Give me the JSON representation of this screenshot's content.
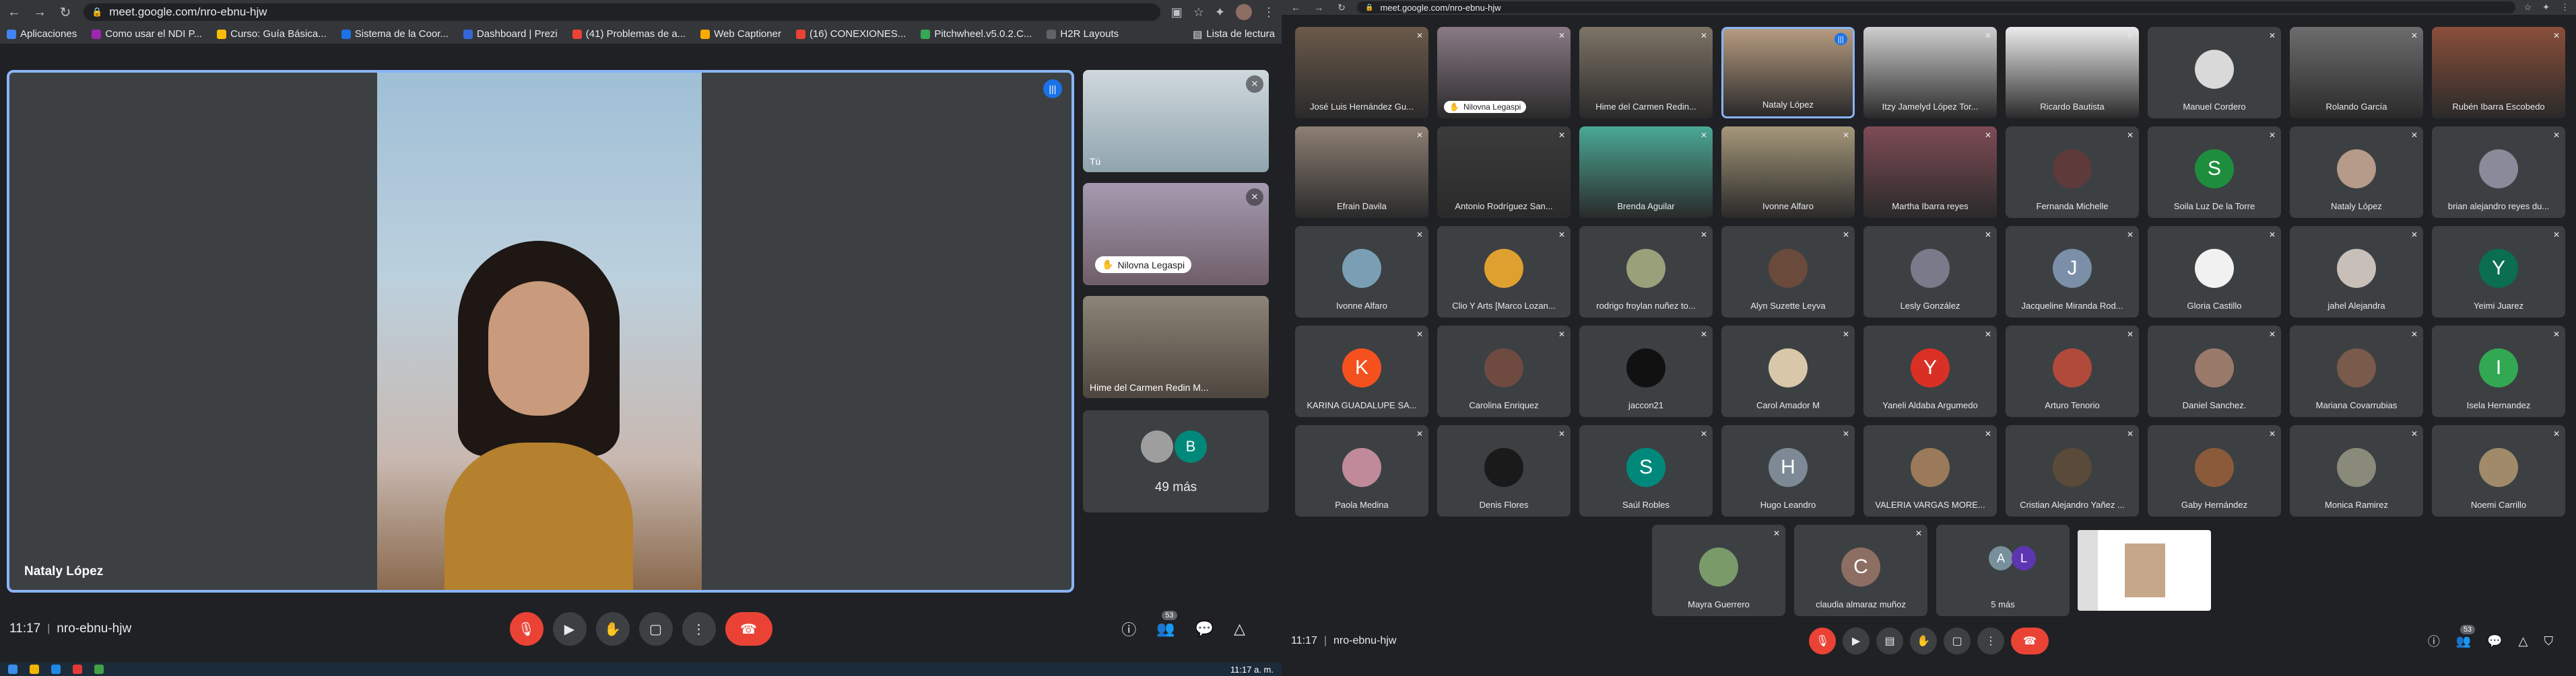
{
  "left": {
    "url": "meet.google.com/nro-ebnu-hjw",
    "bookmarks": [
      "Aplicaciones",
      "Como usar el NDI P...",
      "Curso: Guía Básica...",
      "Sistema de la Coor...",
      "Dashboard | Prezi",
      "(41) Problemas de a...",
      "Web Captioner",
      "(16) CONEXIONES...",
      "Pitchwheel.v5.0.2.C...",
      "H2R Layouts"
    ],
    "reading_list": "Lista de lectura",
    "main_name": "Nataly López",
    "side": [
      {
        "name": "Tú"
      },
      {
        "name": "Nilovna Legaspi"
      },
      {
        "name": "Hime del Carmen Redin M..."
      }
    ],
    "more_letter": "B",
    "more_label": "49 más",
    "time": "11:17",
    "code": "nro-ebnu-hjw",
    "participants_count": "53",
    "taskbar_time": "11:17 a. m."
  },
  "right": {
    "url": "meet.google.com/nro-ebnu-hjw",
    "tiles": [
      {
        "name": "José Luis Hernández Gu...",
        "type": "video",
        "bg": "#6b5a4a"
      },
      {
        "name": "Nilovna Legaspi",
        "type": "video",
        "bg": "#8a7a86",
        "pill": true
      },
      {
        "name": "Hime del Carmen Redin...",
        "type": "video",
        "bg": "#7d7466"
      },
      {
        "name": "Nataly López",
        "type": "video",
        "bg": "#b69b7f",
        "speaking": true
      },
      {
        "name": "Itzy Jamelyd López Tor...",
        "type": "video",
        "bg": "#cfcfcf"
      },
      {
        "name": "Ricardo Bautista",
        "type": "video",
        "bg": "#ececec"
      },
      {
        "name": "Manuel Cordero",
        "type": "avatar",
        "bg": "#d9d9d9",
        "letter": ""
      },
      {
        "name": "Rolando García",
        "type": "video",
        "bg": "#6d6d6d"
      },
      {
        "name": "Rubén Ibarra Escobedo",
        "type": "video",
        "bg": "#8a4f3a"
      },
      {
        "name": "Efrain Davila",
        "type": "video",
        "bg": "#8d7f73"
      },
      {
        "name": "Antonio Rodríguez San...",
        "type": "video",
        "bg": "#3b3b3b"
      },
      {
        "name": "Brenda Aguilar",
        "type": "video",
        "bg": "#4aa895"
      },
      {
        "name": "Ivonne Alfaro",
        "type": "video",
        "bg": "#a5977a"
      },
      {
        "name": "Martha Ibarra reyes",
        "type": "video",
        "bg": "#7e4b55"
      },
      {
        "name": "Fernanda Michelle",
        "type": "avatar",
        "bg": "#5e3a3a",
        "letter": ""
      },
      {
        "name": "Soila Luz De la Torre",
        "type": "avatar",
        "bg": "#1e8e3e",
        "letter": "S"
      },
      {
        "name": "Nataly López",
        "type": "avatar",
        "bg": "#b59b88",
        "letter": ""
      },
      {
        "name": "brian alejandro reyes du...",
        "type": "avatar",
        "bg": "#8a8a9a",
        "letter": ""
      },
      {
        "name": "Ivonne Alfaro",
        "type": "avatar",
        "bg": "#7a9fb5",
        "letter": ""
      },
      {
        "name": "Clio Y Arts [Marco Lozan...",
        "type": "avatar",
        "bg": "#e0a030",
        "letter": ""
      },
      {
        "name": "rodrigo froylan nuñez to...",
        "type": "avatar",
        "bg": "#9aa07a",
        "letter": ""
      },
      {
        "name": "Alyn Suzette Leyva",
        "type": "avatar",
        "bg": "#6a4a3a",
        "letter": ""
      },
      {
        "name": "Lesly González",
        "type": "avatar",
        "bg": "#7a7a8a",
        "letter": ""
      },
      {
        "name": "Jacqueline Miranda Rod...",
        "type": "avatar",
        "bg": "#7b8fa8",
        "letter": "J"
      },
      {
        "name": "Gloria Castillo",
        "type": "avatar",
        "bg": "#f1f1f1",
        "letter": ""
      },
      {
        "name": "jahel Alejandra",
        "type": "avatar",
        "bg": "#c8c0b8",
        "letter": ""
      },
      {
        "name": "Yeimi Juarez",
        "type": "avatar",
        "bg": "#0b6e4f",
        "letter": "Y"
      },
      {
        "name": "KARINA GUADALUPE SA...",
        "type": "avatar",
        "bg": "#f4511e",
        "letter": "K"
      },
      {
        "name": "Carolina Enriquez",
        "type": "avatar",
        "bg": "#6e4a40",
        "letter": ""
      },
      {
        "name": "jaccon21",
        "type": "avatar",
        "bg": "#111111",
        "letter": ""
      },
      {
        "name": "Carol Amador M",
        "type": "avatar",
        "bg": "#d8c7a8",
        "letter": ""
      },
      {
        "name": "Yaneli Aldaba Argumedo",
        "type": "avatar",
        "bg": "#d93025",
        "letter": "Y"
      },
      {
        "name": "Arturo Tenorio",
        "type": "avatar",
        "bg": "#b04a3a",
        "letter": ""
      },
      {
        "name": "Daniel Sanchez.",
        "type": "avatar",
        "bg": "#9a7a6a",
        "letter": ""
      },
      {
        "name": "Mariana Covarrubias",
        "type": "avatar",
        "bg": "#7a5a4a",
        "letter": ""
      },
      {
        "name": "Isela Hernandez",
        "type": "avatar",
        "bg": "#33a852",
        "letter": "I"
      },
      {
        "name": "Paola Medina",
        "type": "avatar",
        "bg": "#c08a9a",
        "letter": ""
      },
      {
        "name": "Denis Flores",
        "type": "avatar",
        "bg": "#1a1a1a",
        "letter": ""
      },
      {
        "name": "Saúl Robles",
        "type": "avatar",
        "bg": "#00897b",
        "letter": "S"
      },
      {
        "name": "Hugo Leandro",
        "type": "avatar",
        "bg": "#7d8a96",
        "letter": "H"
      },
      {
        "name": "VALERIA VARGAS MORE...",
        "type": "avatar",
        "bg": "#9a7a5a",
        "letter": ""
      },
      {
        "name": "Cristian Alejandro Yañez ...",
        "type": "avatar",
        "bg": "#5a4a3a",
        "letter": ""
      },
      {
        "name": "Gaby Hernández",
        "type": "avatar",
        "bg": "#8a5a3a",
        "letter": ""
      },
      {
        "name": "Monica Ramirez",
        "type": "avatar",
        "bg": "#8a8a7a",
        "letter": ""
      },
      {
        "name": "Noemi Carrillo",
        "type": "avatar",
        "bg": "#a08a6a",
        "letter": ""
      }
    ],
    "bottom_tiles": [
      {
        "name": "Mayra Guerrero",
        "type": "avatar",
        "bg": "#7a9a6a",
        "letter": ""
      },
      {
        "name": "claudia almaraz muñoz",
        "type": "avatar",
        "bg": "#8d6e63",
        "letter": "C"
      },
      {
        "name": "5 más",
        "type": "more",
        "letters": [
          "A",
          "L"
        ]
      }
    ],
    "time": "11:17",
    "code": "nro-ebnu-hjw",
    "participants_count": "53"
  },
  "colors": {
    "accent": "#8ab4f8",
    "danger": "#ea4335",
    "surface": "#3c4043",
    "background": "#202124"
  }
}
